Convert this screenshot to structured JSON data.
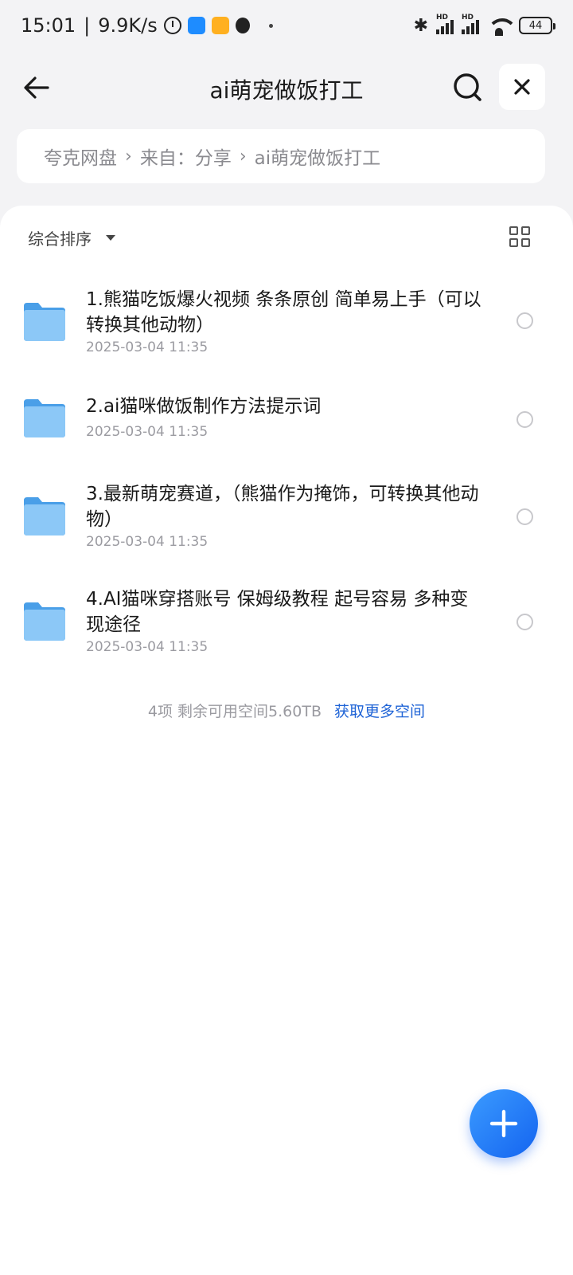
{
  "status_bar": {
    "time": "15:01",
    "separator": "|",
    "speed": "9.9K/s",
    "battery": "44",
    "hd1": "HD",
    "hd2": "HD"
  },
  "header": {
    "title": "ai萌宠做饭打工"
  },
  "breadcrumb": {
    "items": [
      "夸克网盘",
      "来自：分享",
      "ai萌宠做饭打工"
    ]
  },
  "toolbar": {
    "sort_label": "综合排序"
  },
  "files": [
    {
      "name": "1.熊猫吃饭爆火视频 条条原创  简单易上手（可以转换其他动物）",
      "date": "2025-03-04 11:35"
    },
    {
      "name": "2.ai猫咪做饭制作方法提示词",
      "date": "2025-03-04 11:35"
    },
    {
      "name": "3.最新萌宠赛道，（熊猫作为掩饰，可转换其他动物）",
      "date": "2025-03-04 11:35"
    },
    {
      "name": "4.AI猫咪穿搭账号 保姆级教程 起号容易 多种变现途径",
      "date": "2025-03-04 11:35"
    }
  ],
  "footer": {
    "summary": "4项 剩余可用空间5.60TB",
    "link": "获取更多空间"
  },
  "colors": {
    "accent": "#1e63d6",
    "fab": "#1464f0",
    "folder": "#6db7f5"
  }
}
